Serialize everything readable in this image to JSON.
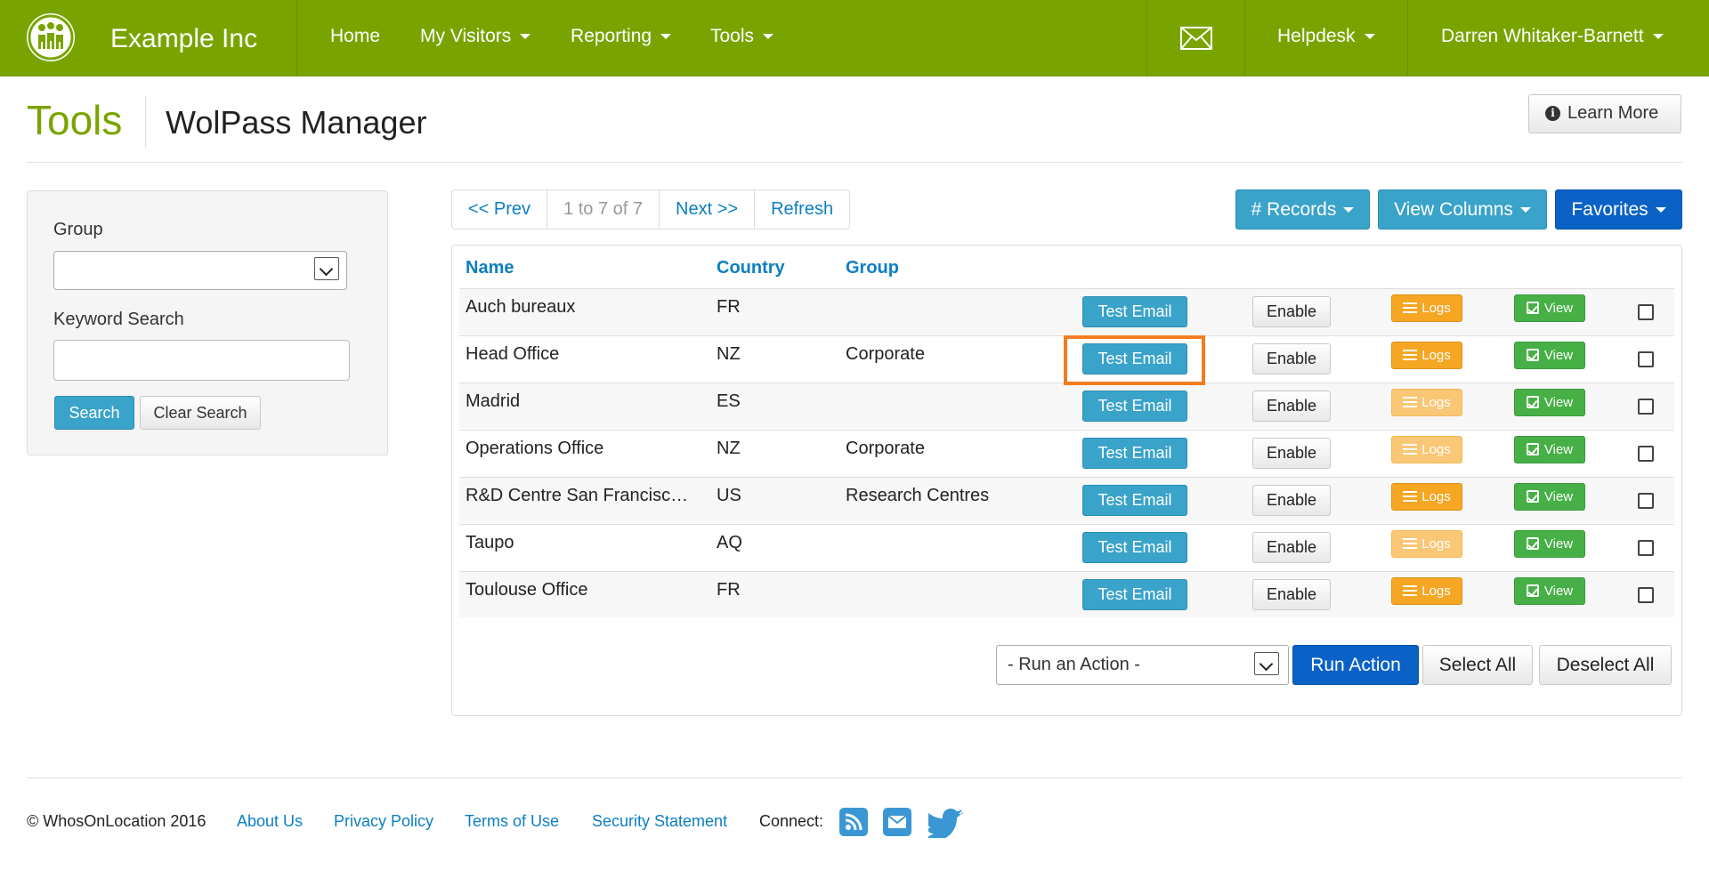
{
  "header": {
    "brand": "Example Inc",
    "nav": [
      {
        "label": "Home"
      },
      {
        "label": "My Visitors"
      },
      {
        "label": "Reporting"
      },
      {
        "label": "Tools"
      }
    ],
    "helpdesk": "Helpdesk",
    "user": "Darren Whitaker-Barnett",
    "brand_color": "#79a400"
  },
  "page": {
    "title": "Tools",
    "subtitle": "WolPass Manager",
    "learn_more": "Learn More"
  },
  "sidebar": {
    "group_label": "Group",
    "group_value": "",
    "keyword_label": "Keyword Search",
    "keyword_value": "",
    "search_button": "Search",
    "clear_button": "Clear Search"
  },
  "pager": {
    "prev": "<< Prev",
    "info": "1 to 7 of 7",
    "next": "Next >>",
    "refresh": "Refresh"
  },
  "toolbar": {
    "records": "# Records",
    "view_columns": "View Columns",
    "favorites": "Favorites"
  },
  "table": {
    "columns": [
      "Name",
      "Country",
      "Group"
    ],
    "rows": [
      {
        "name": "Auch bureaux",
        "country": "FR",
        "group": "",
        "test": "Test Email",
        "enable": "Enable",
        "logs": "Logs",
        "logs_active": true,
        "view": "View"
      },
      {
        "name": "Head Office",
        "country": "NZ",
        "group": "Corporate",
        "test": "Test Email",
        "enable": "Enable",
        "logs": "Logs",
        "logs_active": true,
        "view": "View"
      },
      {
        "name": "Madrid",
        "country": "ES",
        "group": "",
        "test": "Test Email",
        "enable": "Enable",
        "logs": "Logs",
        "logs_active": false,
        "view": "View"
      },
      {
        "name": "Operations Office",
        "country": "NZ",
        "group": "Corporate",
        "test": "Test Email",
        "enable": "Enable",
        "logs": "Logs",
        "logs_active": false,
        "view": "View"
      },
      {
        "name": "R&D Centre San Francisc…",
        "country": "US",
        "group": "Research Centres",
        "test": "Test Email",
        "enable": "Enable",
        "logs": "Logs",
        "logs_active": true,
        "view": "View"
      },
      {
        "name": "Taupo",
        "country": "AQ",
        "group": "",
        "test": "Test Email",
        "enable": "Enable",
        "logs": "Logs",
        "logs_active": false,
        "view": "View"
      },
      {
        "name": "Toulouse Office",
        "country": "FR",
        "group": "",
        "test": "Test Email",
        "enable": "Enable",
        "logs": "Logs",
        "logs_active": true,
        "view": "View"
      }
    ]
  },
  "actions": {
    "select_placeholder": "- Run an Action -",
    "run": "Run Action",
    "select_all": "Select All",
    "deselect_all": "Deselect All"
  },
  "footer": {
    "copyright": "© WhosOnLocation 2016",
    "links": [
      "About Us",
      "Privacy Policy",
      "Terms of Use",
      "Security Statement"
    ],
    "connect": "Connect:",
    "social_icons": [
      "rss-icon",
      "email-icon",
      "twitter-icon"
    ]
  }
}
